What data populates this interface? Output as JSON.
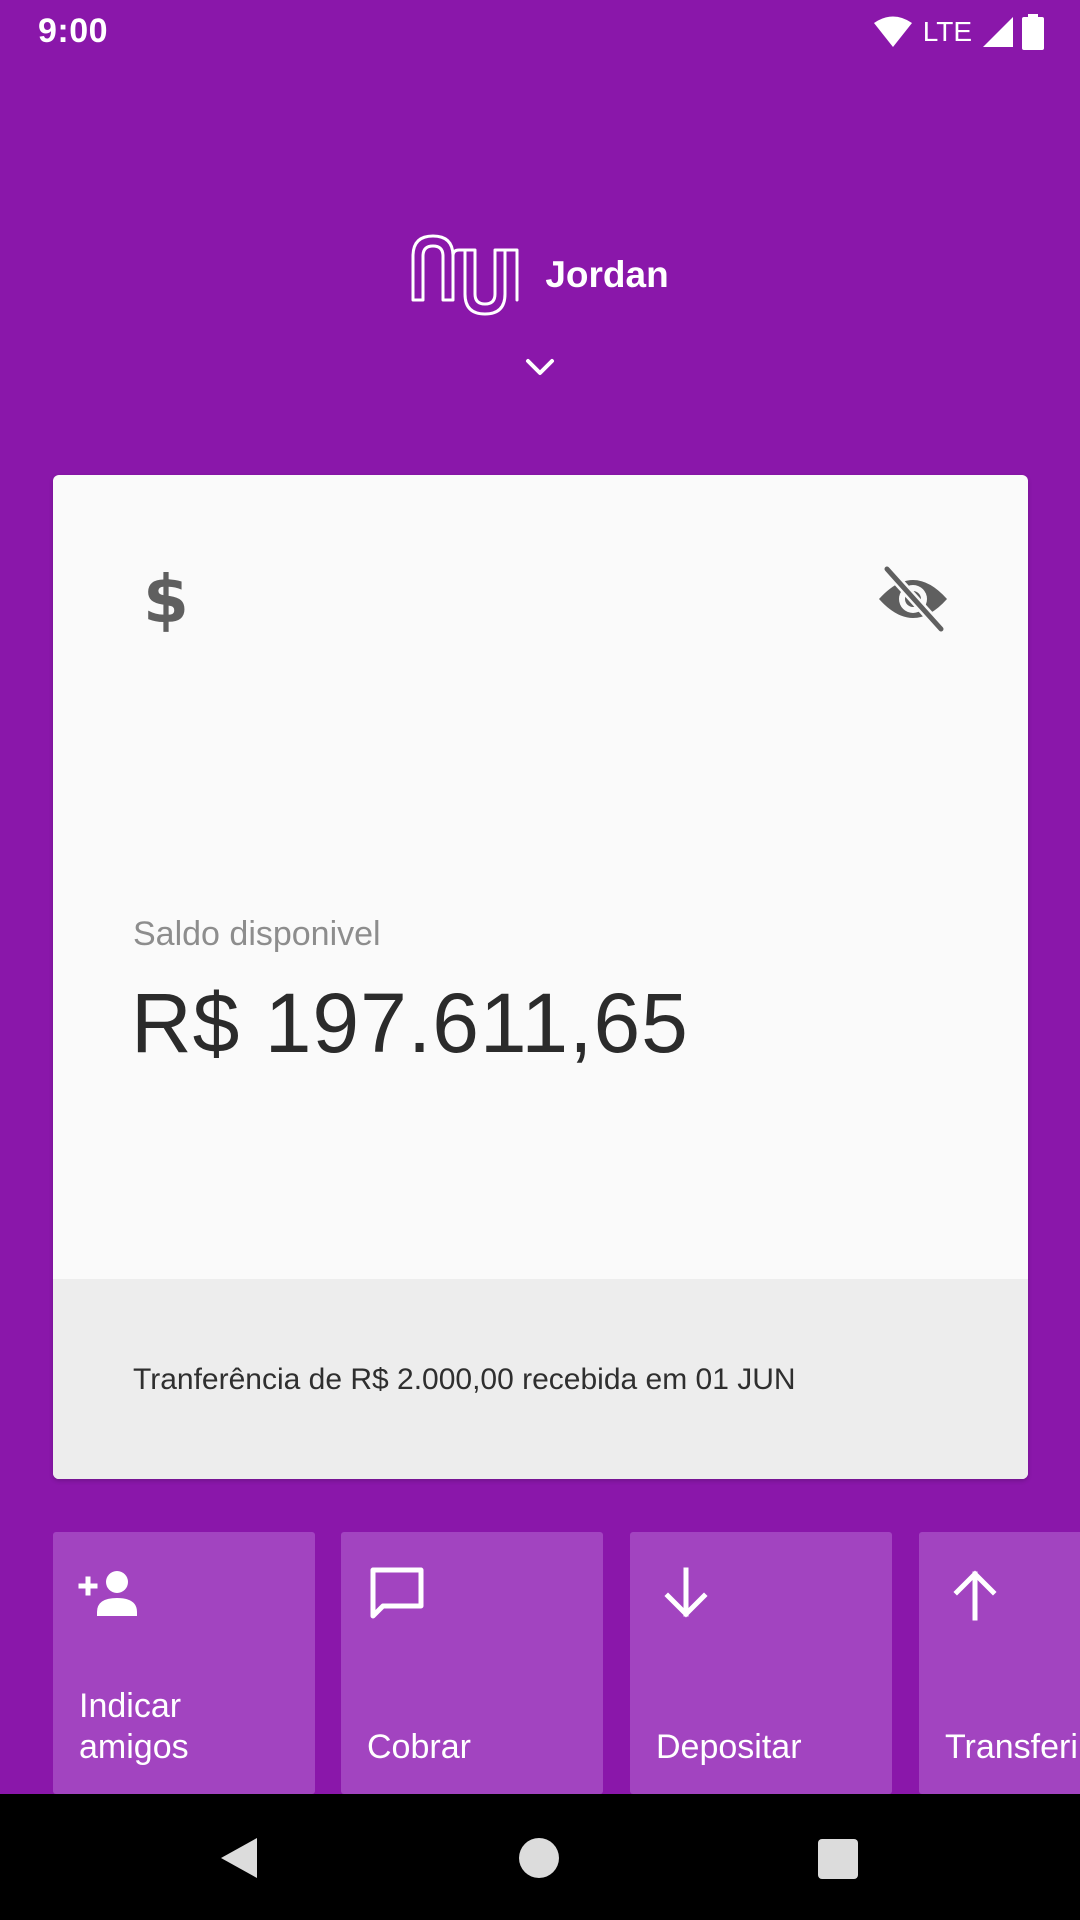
{
  "status_bar": {
    "time": "9:00",
    "network": "LTE",
    "icons": [
      "wifi-icon",
      "signal-icon",
      "battery-icon"
    ]
  },
  "header": {
    "logo": "nu",
    "account_name": "Jordan",
    "expand_icon": "chevron-down-icon"
  },
  "card": {
    "section_icon": "dollar-icon",
    "visibility_icon": "eye-off-icon",
    "balance_label": "Saldo disponivel",
    "balance_value": "R$ 197.611,65",
    "last_activity": "Tranferência de R$ 2.000,00 recebida em 01 JUN"
  },
  "shortcuts": [
    {
      "label": "Indicar\namigos",
      "icon": "add-person-icon"
    },
    {
      "label": "Cobrar",
      "icon": "message-icon"
    },
    {
      "label": "Depositar",
      "icon": "arrow-down-icon"
    },
    {
      "label": "Transferir",
      "icon": "arrow-up-icon"
    }
  ],
  "colors": {
    "brand_purple": "#8a17aa",
    "tile_purple": "#a244c0",
    "card_bg": "#fafafa",
    "card_footer_bg": "#ededed"
  }
}
